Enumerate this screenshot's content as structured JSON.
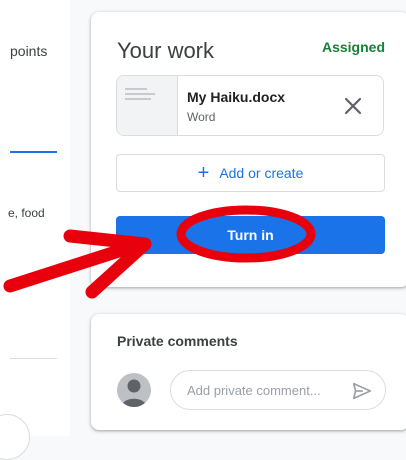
{
  "left": {
    "points_label": "points",
    "food_text": "e, food"
  },
  "work": {
    "title": "Your work",
    "status": "Assigned",
    "attachment": {
      "name": "My Haiku.docx",
      "type": "Word"
    },
    "add_label": "Add or create",
    "turn_in_label": "Turn in"
  },
  "comments": {
    "title": "Private comments",
    "placeholder": "Add private comment..."
  },
  "colors": {
    "accent": "#1a73e8",
    "assigned": "#188038",
    "annotation": "#e8000d"
  },
  "icons": {
    "remove": "close-icon",
    "add": "plus-icon",
    "send": "send-icon",
    "avatar": "person-icon"
  }
}
